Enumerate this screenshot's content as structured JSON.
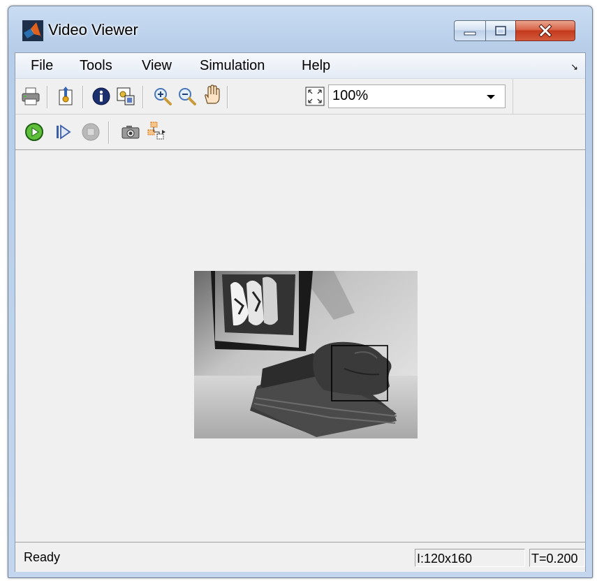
{
  "window": {
    "title": "Video Viewer",
    "controls": [
      "minimize-icon",
      "maximize-icon",
      "close-icon"
    ],
    "colors": {
      "close_button": "#c3391c",
      "frame": "#b7cde8",
      "client": "#f0f0f0"
    }
  },
  "menubar": {
    "items": [
      "File",
      "Tools",
      "View",
      "Simulation",
      "Help"
    ],
    "dock_arrow": "↘"
  },
  "toolbar1": {
    "buttons": [
      "print-icon",
      "export-icon",
      "info-icon",
      "zoom-to-fit-icon",
      "zoom-in-icon",
      "zoom-out-icon",
      "pan-hand-icon",
      "fit-view-icon"
    ],
    "zoom_level": "100%"
  },
  "toolbar2": {
    "buttons": [
      "play-icon",
      "step-forward-icon",
      "stop-icon",
      "snapshot-camera-icon",
      "highlight-block-icon"
    ]
  },
  "video": {
    "content": "grayscale frame with tracking rectangle",
    "rect_color": "#000000"
  },
  "statusbar": {
    "status": "Ready",
    "image_dims": "I:120x160",
    "time": "T=0.200"
  }
}
